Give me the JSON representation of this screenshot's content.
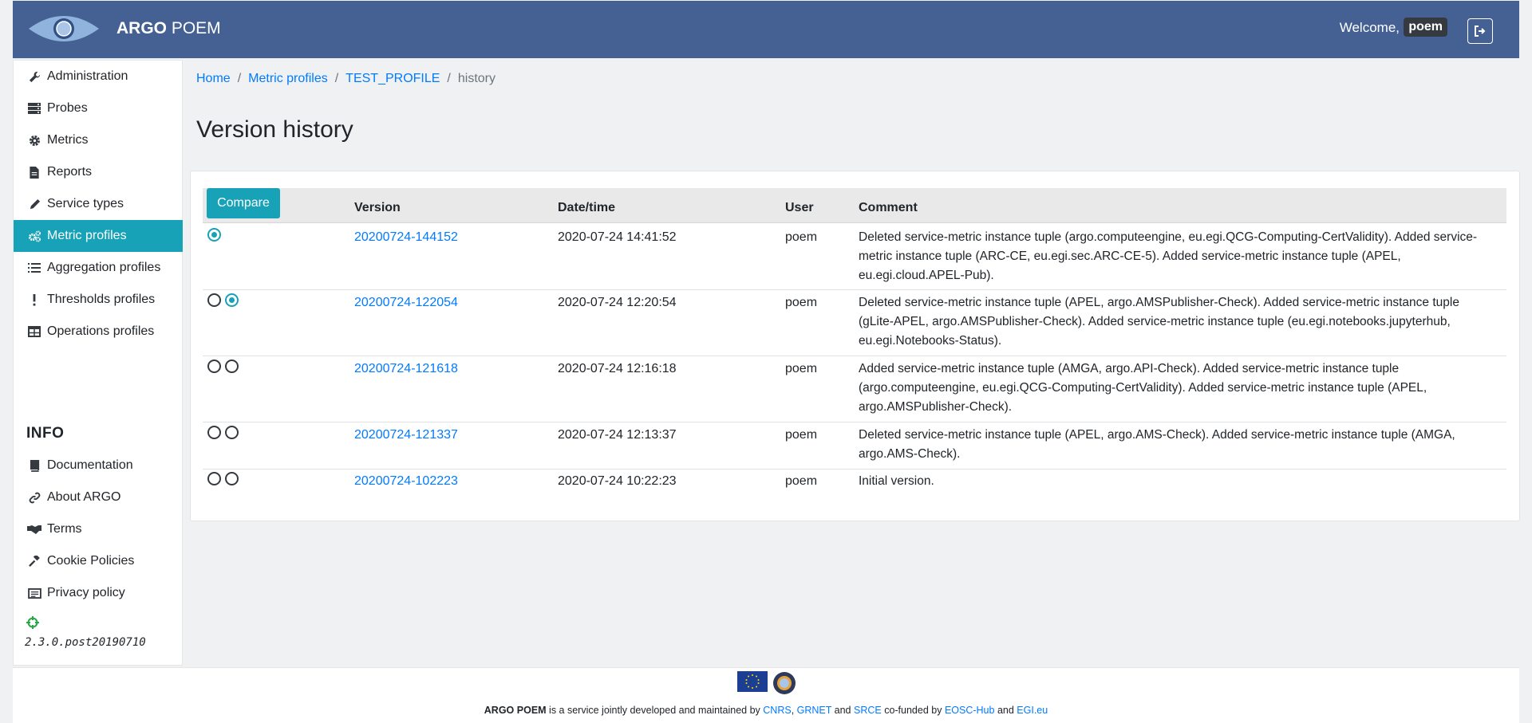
{
  "header": {
    "brand_bold": "ARGO",
    "brand_rest": " POEM",
    "welcome": "Welcome,",
    "username": "poem"
  },
  "sidebar": {
    "items": [
      {
        "label": "Administration",
        "icon": "wrench-icon"
      },
      {
        "label": "Probes",
        "icon": "server-icon"
      },
      {
        "label": "Metrics",
        "icon": "cog-icon"
      },
      {
        "label": "Reports",
        "icon": "file-icon"
      },
      {
        "label": "Service types",
        "icon": "pen-icon"
      },
      {
        "label": "Metric profiles",
        "icon": "cogs-icon",
        "active": true
      },
      {
        "label": "Aggregation profiles",
        "icon": "list-icon"
      },
      {
        "label": "Thresholds profiles",
        "icon": "exclamation-icon"
      },
      {
        "label": "Operations profiles",
        "icon": "table-icon"
      }
    ],
    "info_title": "INFO",
    "info_items": [
      {
        "label": "Documentation",
        "icon": "book-icon"
      },
      {
        "label": "About ARGO",
        "icon": "link-icon"
      },
      {
        "label": "Terms",
        "icon": "handshake-icon"
      },
      {
        "label": "Cookie Policies",
        "icon": "gavel-icon"
      },
      {
        "label": "Privacy policy",
        "icon": "newspaper-icon"
      }
    ],
    "version": "2.3.0.post20190710"
  },
  "breadcrumb": {
    "home": "Home",
    "metric_profiles": "Metric profiles",
    "profile": "TEST_PROFILE",
    "current": "history"
  },
  "main": {
    "title": "Version history",
    "compare_label": "Compare",
    "columns": {
      "version": "Version",
      "datetime": "Date/time",
      "user": "User",
      "comment": "Comment"
    },
    "rows": [
      {
        "version": "20200724-144152",
        "datetime": "2020-07-24 14:41:52",
        "user": "poem",
        "comment": "Deleted service-metric instance tuple (argo.computeengine, eu.egi.QCG-Computing-CertValidity). Added service-metric instance tuple (ARC-CE, eu.egi.sec.ARC-CE-5). Added service-metric instance tuple (APEL, eu.egi.cloud.APEL-Pub)."
      },
      {
        "version": "20200724-122054",
        "datetime": "2020-07-24 12:20:54",
        "user": "poem",
        "comment": "Deleted service-metric instance tuple (APEL, argo.AMSPublisher-Check). Added service-metric instance tuple (gLite-APEL, argo.AMSPublisher-Check). Added service-metric instance tuple (eu.egi.notebooks.jupyterhub, eu.egi.Notebooks-Status)."
      },
      {
        "version": "20200724-121618",
        "datetime": "2020-07-24 12:16:18",
        "user": "poem",
        "comment": "Added service-metric instance tuple (AMGA, argo.API-Check). Added service-metric instance tuple (argo.computeengine, eu.egi.QCG-Computing-CertValidity). Added service-metric instance tuple (APEL, argo.AMSPublisher-Check)."
      },
      {
        "version": "20200724-121337",
        "datetime": "2020-07-24 12:13:37",
        "user": "poem",
        "comment": "Deleted service-metric instance tuple (APEL, argo.AMS-Check). Added service-metric instance tuple (AMGA, argo.AMS-Check)."
      },
      {
        "version": "20200724-102223",
        "datetime": "2020-07-24 10:22:23",
        "user": "poem",
        "comment": "Initial version."
      }
    ]
  },
  "footer": {
    "brand": "ARGO POEM",
    "text1": " is a service jointly developed and maintained by ",
    "cnrs": "CNRS",
    "comma": ", ",
    "grnet": "GRNET",
    "and1": " and ",
    "srce": "SRCE",
    "cofunded": " co-funded by ",
    "eosc": "EOSC-Hub",
    "and2": " and ",
    "egi": "EGI.eu"
  },
  "colors": {
    "header_bg": "#456194",
    "accent": "#17a2b8",
    "link": "#007bff"
  }
}
